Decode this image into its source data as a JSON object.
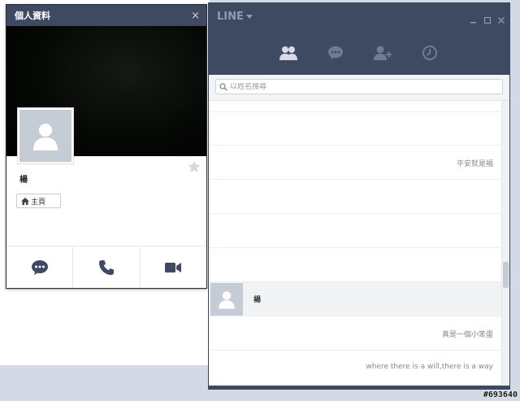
{
  "profile_window": {
    "title": "個人資料",
    "close_symbol": "×",
    "name": "楊",
    "home_label": "主頁",
    "icons": {
      "avatar": "person-placeholder-icon",
      "favorite": "star-icon",
      "home": "home-icon",
      "chat": "chat-bubble-icon",
      "call": "phone-icon",
      "video": "video-camera-icon"
    }
  },
  "main_window": {
    "app_title": "LINE",
    "controls": {
      "minimize": "_",
      "maximize": "□",
      "close": "×"
    },
    "tabs": [
      {
        "name": "friends",
        "icon": "friends-icon"
      },
      {
        "name": "chats",
        "icon": "chat-bubble-icon"
      },
      {
        "name": "add-friend",
        "icon": "add-friend-icon"
      },
      {
        "name": "timeline",
        "icon": "clock-icon"
      }
    ],
    "search": {
      "placeholder": "以姓名搜尋"
    },
    "friends": [
      {
        "name": "",
        "status": ""
      },
      {
        "name": "",
        "status": "平安就是福"
      },
      {
        "name": "",
        "status": ""
      },
      {
        "name": "",
        "status": ""
      },
      {
        "name": "",
        "status": ""
      },
      {
        "name": "楊",
        "status": ""
      },
      {
        "name": "",
        "status": "真是一個小笨蛋"
      },
      {
        "name": "",
        "status": "where there is a will,there is a way"
      }
    ]
  },
  "colors": {
    "header_navy": "#3e4a62",
    "tab_icon": "#8d9ab2",
    "avatar_grey": "#c6ccd6"
  },
  "watermark": "#693640"
}
